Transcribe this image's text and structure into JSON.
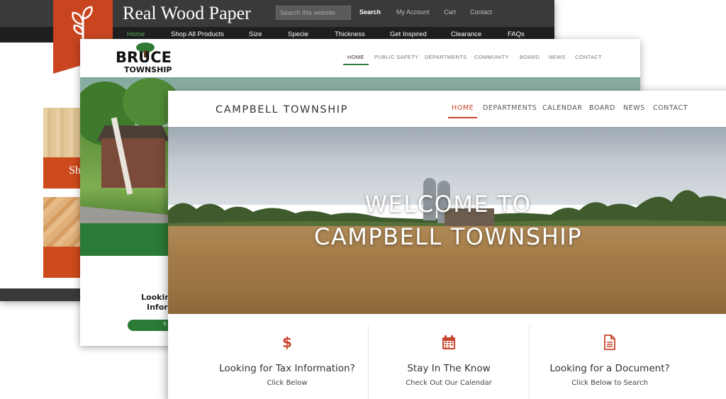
{
  "realwood": {
    "title": "Real Wood Paper",
    "search_placeholder": "Search this website",
    "top_links": [
      "Search",
      "My Account",
      "Cart",
      "Contact"
    ],
    "nav": [
      "Home",
      "Shop All Products",
      "Size",
      "Specie",
      "Thickness",
      "Get Inspired",
      "Clearance",
      "FAQs"
    ],
    "product_band_label": "Sh",
    "colors": {
      "accent": "#c8451f",
      "nav_active": "#58b05a"
    }
  },
  "bruce": {
    "logo_main": "BRUCE",
    "logo_sub": "TOWNSHIP",
    "nav": [
      "HOME",
      "PUBLIC SAFETY",
      "DEPARTMENTS",
      "COMMUNITY",
      "BOARD",
      "NEWS",
      "CONTACT"
    ],
    "partial_heading_1": "Lookin",
    "partial_heading_2": "Inforr",
    "partial_button": "S",
    "colors": {
      "brand_green": "#2b7a35"
    }
  },
  "campbell": {
    "site_title": "CAMPBELL TOWNSHIP",
    "nav": [
      "HOME",
      "DEPARTMENTS",
      "CALENDAR",
      "BOARD",
      "NEWS",
      "CONTACT"
    ],
    "hero_line_1": "WELCOME TO",
    "hero_line_2": "CAMPBELL TOWNSHIP",
    "slide_count": 4,
    "active_slide": 1,
    "cards": [
      {
        "icon": "dollar-icon",
        "title": "Looking for Tax Information?",
        "subtitle": "Click Below"
      },
      {
        "icon": "calendar-icon",
        "title": "Stay In The Know",
        "subtitle": "Check Out Our Calendar"
      },
      {
        "icon": "document-icon",
        "title": "Looking for a Document?",
        "subtitle": "Click Below to Search"
      }
    ],
    "colors": {
      "accent": "#c8452c"
    }
  }
}
